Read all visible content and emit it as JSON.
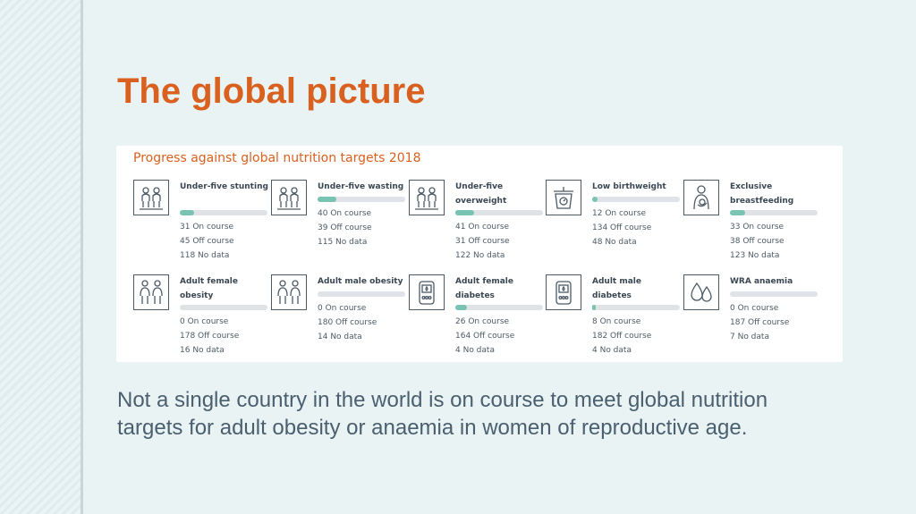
{
  "slide": {
    "title": "The global picture",
    "caption": "Not a single country in the world is on course to meet global nutrition targets for adult obesity or anaemia in women of reproductive age."
  },
  "panel": {
    "title": "Progress against global nutrition targets 2018",
    "colors": {
      "title": "#d9601f",
      "bar_track": "#dfe3e7",
      "bar_fill": "#78c3b1",
      "icon_stroke": "#4c5a66"
    },
    "indicators": [
      {
        "name": "Under-five stunting",
        "icon": "children-icon",
        "on": "31 On course",
        "off": "45 Off course",
        "nodata": "118 No data",
        "on_fraction": 0.16
      },
      {
        "name": "Under-five wasting",
        "icon": "children-icon",
        "on": "40 On course",
        "off": "39 Off course",
        "nodata": "115 No data",
        "on_fraction": 0.21
      },
      {
        "name": "Under-five overweight",
        "icon": "children-icon",
        "on": "41 On course",
        "off": "31 Off course",
        "nodata": "122 No data",
        "on_fraction": 0.21
      },
      {
        "name": "Low birthweight",
        "icon": "scale-icon",
        "on": "12 On course",
        "off": "134 Off course",
        "nodata": "48 No data",
        "on_fraction": 0.06
      },
      {
        "name": "Exclusive breastfeeding",
        "icon": "breastfeeding-icon",
        "on": "33 On course",
        "off": "38 Off course",
        "nodata": "123 No data",
        "on_fraction": 0.17
      },
      {
        "name": "Adult female obesity",
        "icon": "adults-icon",
        "on": "0 On course",
        "off": "178 Off course",
        "nodata": "16 No data",
        "on_fraction": 0
      },
      {
        "name": "Adult male obesity",
        "icon": "adults-icon",
        "on": "0 On course",
        "off": "180 Off course",
        "nodata": "14 No data",
        "on_fraction": 0
      },
      {
        "name": "Adult female diabetes",
        "icon": "glucose-meter-icon",
        "on": "26 On course",
        "off": "164 Off course",
        "nodata": "4 No data",
        "on_fraction": 0.13
      },
      {
        "name": "Adult male diabetes",
        "icon": "glucose-meter-icon",
        "on": "8 On course",
        "off": "182 Off course",
        "nodata": "4 No data",
        "on_fraction": 0.04
      },
      {
        "name": "WRA anaemia",
        "icon": "blood-drop-icon",
        "on": "0 On course",
        "off": "187 Off course",
        "nodata": "7 No data",
        "on_fraction": 0
      }
    ]
  }
}
